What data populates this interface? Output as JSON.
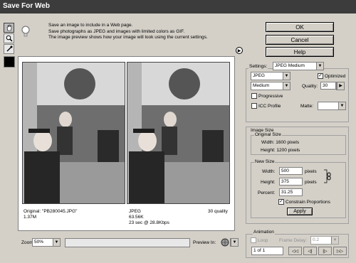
{
  "window": {
    "title": "Save For Web"
  },
  "tools": [
    {
      "icon": "hand-icon"
    },
    {
      "icon": "zoom-icon"
    },
    {
      "icon": "eyedropper-icon"
    }
  ],
  "info": {
    "line1": "Save an image to include in a Web page.",
    "line2": "Save photographs as JPEG and images with limited colors as GIF.",
    "line3": "The image preview shows how your image will look using the current settings."
  },
  "original": {
    "name": "Original: \"PB280045.JPG\"",
    "size": "1.37M"
  },
  "optimized": {
    "format": "JPEG",
    "size": "63.56K",
    "time": "23 sec @ 28.8Kbps",
    "quality_text": "30 quality"
  },
  "buttons": {
    "ok": "OK",
    "cancel": "Cancel",
    "help": "Help"
  },
  "settings": {
    "label": "Settings:",
    "preset": "JPEG Medium",
    "format": "JPEG",
    "optimized_label": "Optimized",
    "optimized_checked": true,
    "compression": "Medium",
    "quality_label": "Quality:",
    "quality_value": "30",
    "progressive_label": "Progressive",
    "progressive_checked": false,
    "icc_label": "ICC Profile",
    "icc_checked": false,
    "matte_label": "Matte:"
  },
  "image_size": {
    "title": "Image Size",
    "original_title": "Original Size",
    "orig_width": "Width:  1600 pixels",
    "orig_height": "Height:  1200 pixels",
    "new_title": "New Size",
    "width_label": "Width:",
    "width_value": "500",
    "height_label": "Height:",
    "height_value": "375",
    "unit1": "pixels",
    "unit2": "pixels",
    "percent_label": "Percent:",
    "percent_value": "31.25",
    "constrain_label": "Constrain Proportions",
    "constrain_checked": true,
    "apply_label": "Apply"
  },
  "animation": {
    "title": "Animation",
    "loop_label": "Loop",
    "frame_delay_label": "Frame Delay:",
    "frame_delay_value": "0.2",
    "frame_counter": "1 of 1"
  },
  "bottom": {
    "zoom_label": "Zoom:",
    "zoom_value": "50%",
    "preview_in_label": "Preview In:"
  }
}
